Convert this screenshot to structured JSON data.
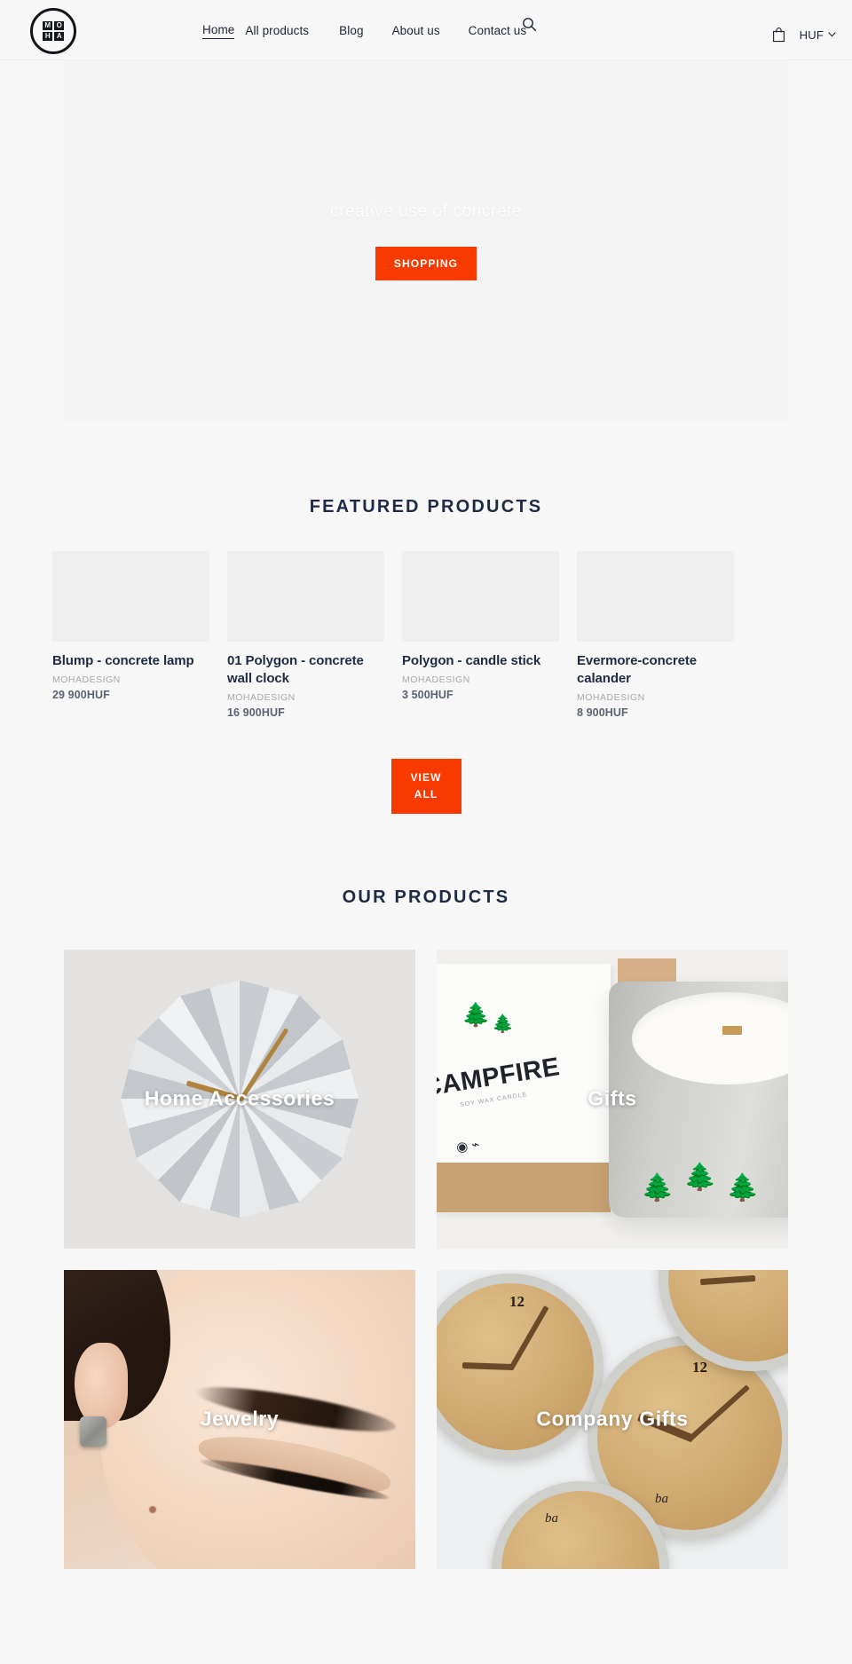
{
  "header": {
    "logo": {
      "name": "MOHA",
      "cells": [
        "MO",
        "",
        "HA",
        ""
      ],
      "line1a": "M",
      "line1b": "O",
      "line2a": "H",
      "line2b": "A"
    },
    "nav": [
      {
        "label": "Home",
        "active": true
      },
      {
        "label": "All products",
        "active": false
      },
      {
        "label": "Blog",
        "active": false
      },
      {
        "label": "About us",
        "active": false
      },
      {
        "label": "Contact us",
        "active": false
      }
    ],
    "search_icon": "search-icon",
    "cart_icon": "shopping-bag-icon",
    "currency": "HUF",
    "currency_chevron": "⌄"
  },
  "hero": {
    "title": "creative use of concrete",
    "cta_label": "SHOPPING",
    "cta_color": "#f93a00"
  },
  "featured": {
    "title": "FEATURED PRODUCTS",
    "products": [
      {
        "name": "Blump - concrete lamp",
        "vendor": "MOHADESIGN",
        "price": "29 900HUF"
      },
      {
        "name": "01 Polygon - concrete wall clock",
        "vendor": "MOHADESIGN",
        "price": "16 900HUF"
      },
      {
        "name": "Polygon - candle stick",
        "vendor": "MOHADESIGN",
        "price": "3 500HUF"
      },
      {
        "name": "Evermore-concrete calander",
        "vendor": "MOHADESIGN",
        "price": "8 900HUF"
      }
    ],
    "view_all_label": "VIEW ALL"
  },
  "collections": {
    "title": "OUR PRODUCTS",
    "tiles": [
      {
        "label": "Home Accessories"
      },
      {
        "label": "Gifts"
      },
      {
        "label": "Jewelry"
      },
      {
        "label": "Company Gifts"
      }
    ]
  },
  "artwork": {
    "candle_box_brand": "CAMPFIRE",
    "candle_box_sub": "SOY WAX CANDLE",
    "cork_script": "ba"
  },
  "theme": {
    "accent": "#f93a00",
    "heading": "#1f2b45",
    "page_bg": "#f7f7f7",
    "muted": "#a6a9ad"
  }
}
